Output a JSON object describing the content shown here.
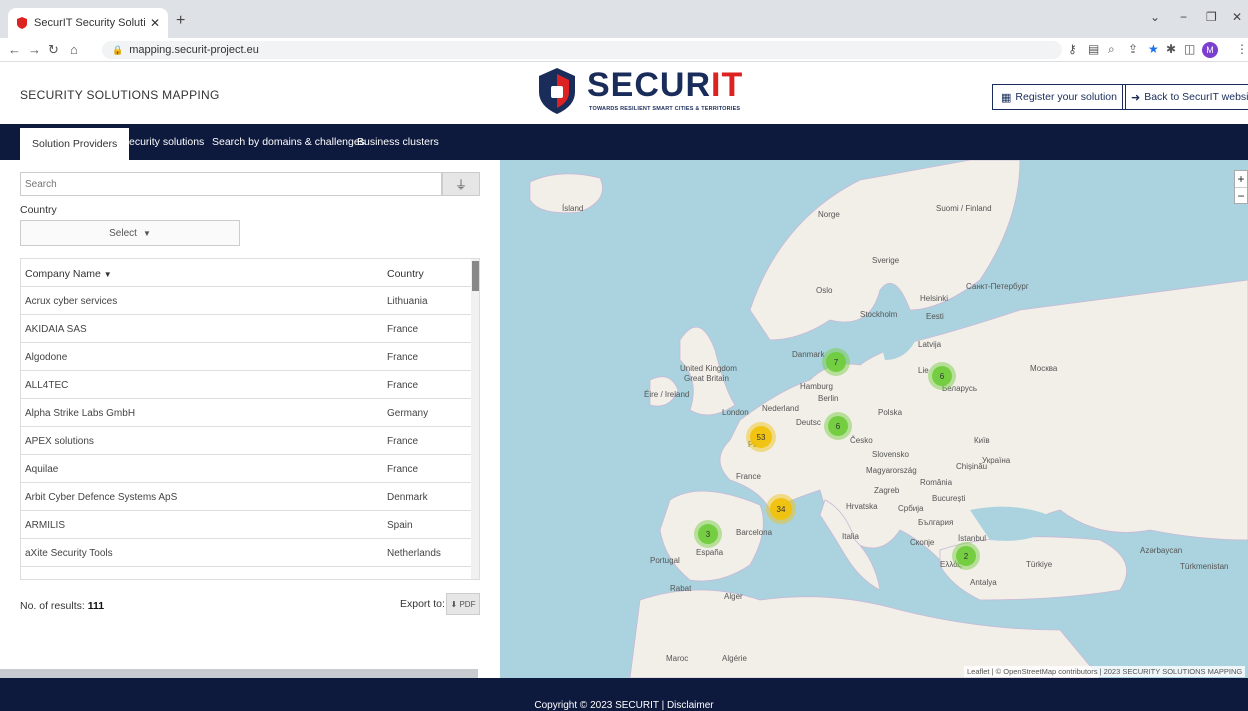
{
  "browser": {
    "tab_title": "SecurIT Security Solutions Mapp",
    "url": "mapping.securit-project.eu",
    "avatar_letter": "M"
  },
  "header": {
    "site_title": "SECURITY SOLUTIONS MAPPING",
    "logo_word_a": "SECUR",
    "logo_word_b": "IT",
    "logo_tagline": "TOWARDS RESILIENT SMART CITIES & TERRITORIES",
    "register_label": "Register your solution",
    "back_label": "Back to SecurIT website"
  },
  "nav": {
    "tabs": [
      "Solution Providers",
      "Security solutions",
      "Search by domains & challenges",
      "Business clusters"
    ]
  },
  "filters": {
    "search_placeholder": "Search",
    "country_label": "Country",
    "select_label": "Select"
  },
  "table": {
    "headers": [
      "Company Name",
      "Country"
    ],
    "rows": [
      [
        "Acrux cyber services",
        "Lithuania"
      ],
      [
        "AKIDAIA SAS",
        "France"
      ],
      [
        "Algodone",
        "France"
      ],
      [
        "ALL4TEC",
        "France"
      ],
      [
        "Alpha Strike Labs GmbH",
        "Germany"
      ],
      [
        "APEX solutions",
        "France"
      ],
      [
        "Aquilae",
        "France"
      ],
      [
        "Arbit Cyber Defence Systems ApS",
        "Denmark"
      ],
      [
        "ARMILIS",
        "Spain"
      ],
      [
        "aXite Security Tools",
        "Netherlands"
      ]
    ]
  },
  "results": {
    "label": "No. of results:",
    "count": "111",
    "export_label": "Export to:",
    "pdf_label": "PDF"
  },
  "map": {
    "clusters": [
      {
        "count": "7",
        "color": "green"
      },
      {
        "count": "6",
        "color": "green"
      },
      {
        "count": "6",
        "color": "green"
      },
      {
        "count": "53",
        "color": "yellow"
      },
      {
        "count": "34",
        "color": "yellow"
      },
      {
        "count": "3",
        "color": "green"
      },
      {
        "count": "2",
        "color": "green"
      }
    ],
    "labels": [
      "Ísland",
      "Norge",
      "Suomi / Finland",
      "Sverige",
      "Oslo",
      "Helsinki",
      "Санкт-Петербург",
      "Stockholm",
      "Eesti",
      "Latvija",
      "Danmark",
      "Lie",
      "Москва",
      "United Kingdom",
      "Great Britain",
      "Éire / Ireland",
      "Hamburg",
      "Berlin",
      "Беларусь",
      "London",
      "Nederland",
      "Polska",
      "Deutsc",
      "Pa",
      "Česko",
      "Київ",
      "Slovensko",
      "Україна",
      "France",
      "Magyarország",
      "Chișinău",
      "Zagreb",
      "România",
      "Hrvatska",
      "Србија",
      "București",
      "България",
      "Barcelona",
      "Italia",
      "Скопје",
      "İstanbul",
      "España",
      "Portugal",
      "Ελλάς",
      "Türkiye",
      "Antalya",
      "Rabat",
      "Alger",
      "Maroc",
      "Algérie",
      "Azərbaycan",
      "Türkmenistan"
    ],
    "zoom_in": "+",
    "zoom_out": "−",
    "attribution": "Leaflet | © OpenStreetMap contributors | 2023 SECURITY SOLUTIONS MAPPING"
  },
  "footer": {
    "copyright": "Copyright © 2023 SECURIT | Disclaimer"
  },
  "colors": {
    "navy": "#0e1a3d",
    "accent_red": "#dd2222",
    "cluster_green": "#6ecc39",
    "cluster_yellow": "#f0c20c",
    "sea": "#abd3df"
  }
}
